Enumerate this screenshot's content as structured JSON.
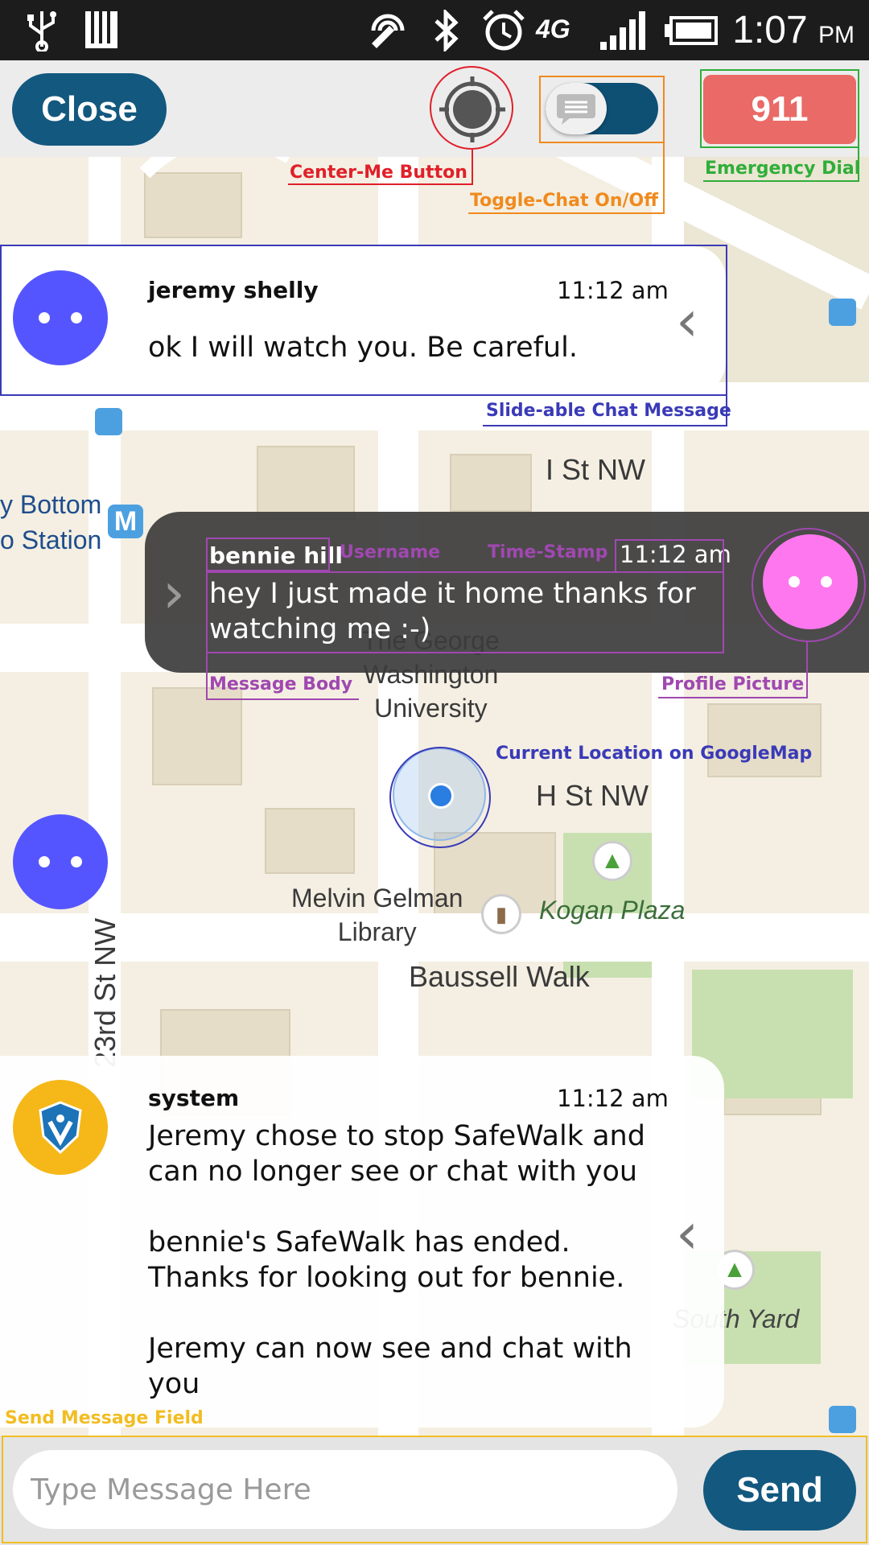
{
  "status_bar": {
    "time": "1:07",
    "ampm": "PM",
    "network": "4G",
    "icons": [
      "usb-icon",
      "sd-card-icon",
      "nfc-icon",
      "bluetooth-icon",
      "alarm-icon",
      "signal-icon",
      "battery-icon"
    ]
  },
  "toolbar": {
    "close_label": "Close",
    "emergency_label": "911",
    "toggle_chat_on": true
  },
  "annotations": {
    "center_me": "Center-Me Button",
    "toggle_chat": "Toggle-Chat On/Off",
    "emergency": "Emergency Dial",
    "slideable": "Slide-able Chat Message",
    "username": "Username",
    "timestamp": "Time-Stamp",
    "message_body": "Message Body",
    "profile_picture": "Profile Picture",
    "current_location": "Current Location on GoogleMap",
    "send_field": "Send Message Field"
  },
  "messages": [
    {
      "user": "jeremy shelly",
      "time": "11:12 am",
      "body": "ok I will watch you.  Be careful.",
      "avatar_color": "#5555ff"
    },
    {
      "user": "bennie hill",
      "time": "11:12 am",
      "body": "hey I just made it home thanks for\nwatching me :-)",
      "avatar_color": "#ff77ee"
    },
    {
      "user": "system",
      "time": "11:12 am",
      "body": "Jeremy chose to stop SafeWalk and\ncan no longer see or chat with you\n\nbennie's SafeWalk has ended.\nThanks for looking out for bennie.\n\nJeremy can now see and chat with\nyou",
      "avatar_color": "#f5b818"
    }
  ],
  "map": {
    "labels": {
      "i_st": "I St NW",
      "h_st": "H St NW",
      "foggy_1": "y Bottom",
      "foggy_2": "o Station",
      "gwu": "The George\nWashington\nUniversity",
      "gelman": "Melvin Gelman\nLibrary",
      "kogan": "Kogan Plaza",
      "baussell": "Baussell Walk",
      "st23": "23rd St NW",
      "south_yard": "South Yard",
      "metro": "M"
    }
  },
  "input": {
    "placeholder": "Type Message Here",
    "send_label": "Send"
  }
}
